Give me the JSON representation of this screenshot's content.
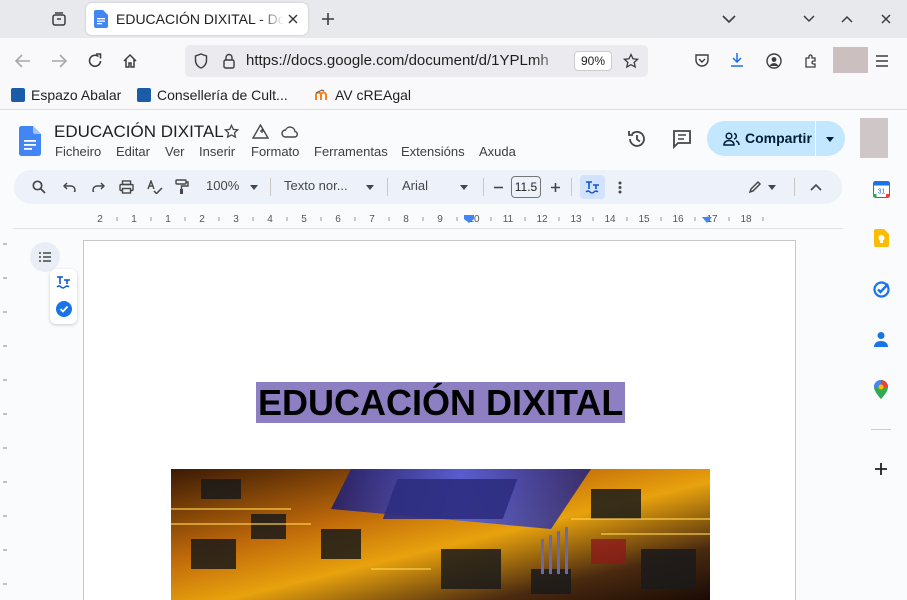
{
  "browser": {
    "tab_title": "EDUCACIÓN DIXITAL - Documentos de Google",
    "url": "https://docs.google.com/document/d/1YPLmh",
    "zoom": "90%",
    "bookmarks": [
      "Espazo Abalar",
      "Consellería de Cult...",
      "AV cREAgal"
    ]
  },
  "docs": {
    "title": "EDUCACIÓN DIXITAL",
    "menu": [
      "Ficheiro",
      "Editar",
      "Ver",
      "Inserir",
      "Formato",
      "Ferramentas",
      "Extensións",
      "Axuda"
    ],
    "share_label": "Compartir"
  },
  "toolbar": {
    "zoom": "100%",
    "style": "Texto nor...",
    "font": "Arial",
    "font_size": "11.5"
  },
  "ruler": {
    "labels": [
      "2",
      "1",
      "1",
      "2",
      "3",
      "4",
      "5",
      "6",
      "7",
      "8",
      "9",
      "10",
      "11",
      "12",
      "13",
      "14",
      "15",
      "16",
      "17",
      "18"
    ]
  },
  "document": {
    "heading": "EDUCACIÓN DIXITAL"
  },
  "colors": {
    "accent": "#1a73e8",
    "share_bg": "#c2e7ff",
    "selection": "#8d7fc2"
  }
}
